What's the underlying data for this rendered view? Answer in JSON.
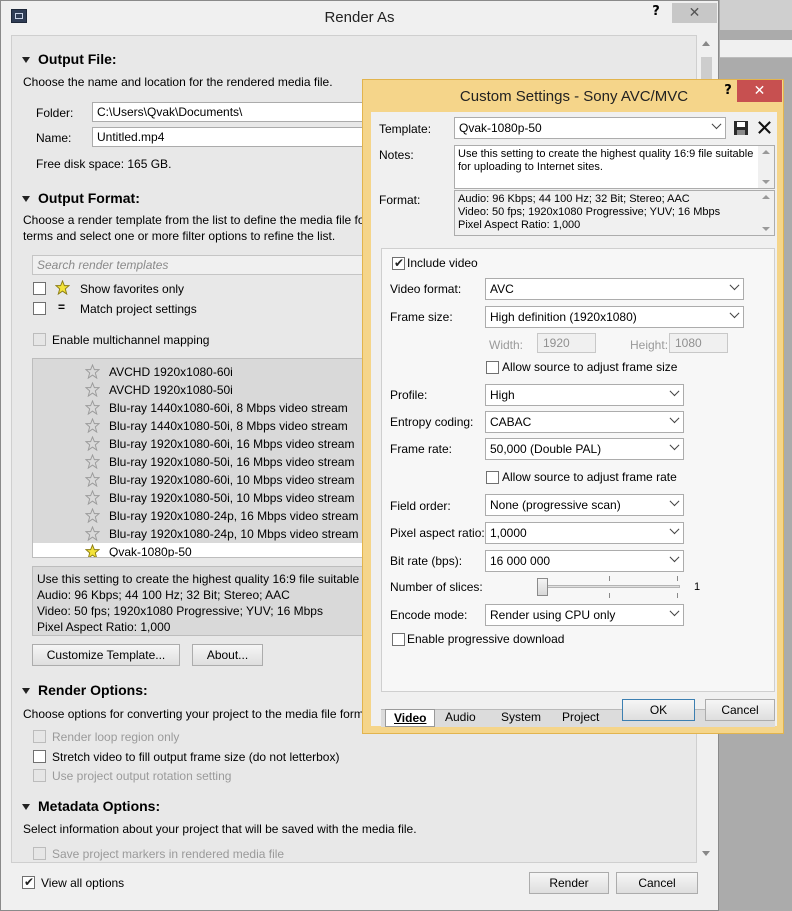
{
  "render_as": {
    "title": "Render As",
    "help": "?",
    "close": "✕",
    "output_file": {
      "heading": "Output File:",
      "description": "Choose the name and location for the rendered media file.",
      "folder_label": "Folder:",
      "folder_value": "C:\\Users\\Qvak\\Documents\\",
      "name_label": "Name:",
      "name_value": "Untitled.mp4",
      "free_space": "Free disk space: 165 GB."
    },
    "output_format": {
      "heading": "Output Format:",
      "description_line1": "Choose a render template from the list to define the media file fo",
      "description_line2": "terms and select one or more filter options to refine the list.",
      "search_placeholder": "Search render templates",
      "show_favorites": "Show favorites only",
      "match_project": "Match project settings",
      "multichannel": "Enable multichannel mapping",
      "templates": [
        {
          "label": "AVCHD 1920x1080-60i",
          "fav": false
        },
        {
          "label": "AVCHD 1920x1080-50i",
          "fav": false
        },
        {
          "label": "Blu-ray 1440x1080-60i, 8 Mbps video stream",
          "fav": false
        },
        {
          "label": "Blu-ray 1440x1080-50i, 8 Mbps video stream",
          "fav": false
        },
        {
          "label": "Blu-ray 1920x1080-60i, 16 Mbps video stream",
          "fav": false
        },
        {
          "label": "Blu-ray 1920x1080-50i, 16 Mbps video stream",
          "fav": false
        },
        {
          "label": "Blu-ray 1920x1080-60i, 10 Mbps video stream",
          "fav": false
        },
        {
          "label": "Blu-ray 1920x1080-50i, 10 Mbps video stream",
          "fav": false
        },
        {
          "label": "Blu-ray 1920x1080-24p, 16 Mbps video stream",
          "fav": false
        },
        {
          "label": "Blu-ray 1920x1080-24p, 10 Mbps video stream",
          "fav": false
        },
        {
          "label": "Qvak-1080p-50",
          "fav": true,
          "selected": true
        }
      ],
      "template_desc": [
        "Use this setting to create the highest quality 16:9 file suitable f",
        "Audio: 96 Kbps; 44 100 Hz; 32 Bit; Stereo; AAC",
        "Video: 50 fps; 1920x1080 Progressive; YUV; 16 Mbps",
        "Pixel Aspect Ratio: 1,000"
      ],
      "customize_button": "Customize Template...",
      "about_button": "About..."
    },
    "render_options": {
      "heading": "Render Options:",
      "description": "Choose options for converting your project to the media file form",
      "loop_region": "Render loop region only",
      "stretch_video": "Stretch video to fill output frame size (do not letterbox)",
      "rotation": "Use project output rotation setting"
    },
    "metadata_options": {
      "heading": "Metadata Options:",
      "description": "Select information about your project that will be saved with the media file.",
      "save_markers": "Save project markers in rendered media file"
    },
    "view_all": "View all options",
    "render_button": "Render",
    "cancel_button": "Cancel"
  },
  "custom_settings": {
    "title": "Custom Settings - Sony AVC/MVC",
    "help": "?",
    "close": "✕",
    "template_label": "Template:",
    "template_value": "Qvak-1080p-50",
    "notes_label": "Notes:",
    "notes_value": "Use this setting to create the highest quality 16:9 file suitable for uploading to Internet sites.",
    "format_label": "Format:",
    "format_lines": [
      "Audio: 96 Kbps; 44 100 Hz; 32 Bit; Stereo; AAC",
      "Video: 50 fps; 1920x1080 Progressive; YUV; 16 Mbps",
      "Pixel Aspect Ratio: 1,000"
    ],
    "include_video": "Include video",
    "video_format_label": "Video format:",
    "video_format_value": "AVC",
    "frame_size_label": "Frame size:",
    "frame_size_value": "High definition (1920x1080)",
    "width_label": "Width:",
    "width_value": "1920",
    "height_label": "Height:",
    "height_value": "1080",
    "allow_frame_size": "Allow source to adjust frame size",
    "profile_label": "Profile:",
    "profile_value": "High",
    "entropy_label": "Entropy coding:",
    "entropy_value": "CABAC",
    "frame_rate_label": "Frame rate:",
    "frame_rate_value": "50,000 (Double PAL)",
    "allow_frame_rate": "Allow source to adjust frame rate",
    "field_order_label": "Field order:",
    "field_order_value": "None (progressive scan)",
    "par_label": "Pixel aspect ratio:",
    "par_value": "1,0000",
    "bitrate_label": "Bit rate (bps):",
    "bitrate_value": "16 000 000",
    "slices_label": "Number of slices:",
    "slices_value": "1",
    "slices_level": 0,
    "encode_label": "Encode mode:",
    "encode_value": "Render using CPU only",
    "progressive_download": "Enable progressive download",
    "tabs": [
      "Video",
      "Audio",
      "System",
      "Project"
    ],
    "active_tab": "Video",
    "ok_button": "OK",
    "cancel_button": "Cancel"
  },
  "colors": {
    "dialog_border": "#f5d58a",
    "close_red": "#c75050",
    "window_bg": "#f0f0f0",
    "star_fav": "#f3e33a"
  }
}
